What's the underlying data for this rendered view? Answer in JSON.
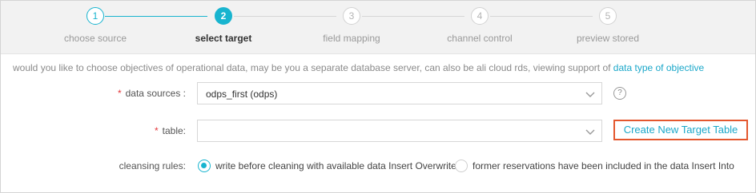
{
  "steps": [
    {
      "number": "1",
      "label": "choose source",
      "state": "done"
    },
    {
      "number": "2",
      "label": "select target",
      "state": "active"
    },
    {
      "number": "3",
      "label": "field mapping",
      "state": "todo"
    },
    {
      "number": "4",
      "label": "channel control",
      "state": "todo"
    },
    {
      "number": "5",
      "label": "preview stored",
      "state": "todo"
    }
  ],
  "info": {
    "text": "would you like to choose objectives of operational data, may be you a separate database server, can also be ali cloud rds, viewing support of ",
    "link": "data type of objective"
  },
  "form": {
    "data_sources": {
      "required_mark": "*",
      "label": "data sources :",
      "value": "odps_first (odps)",
      "help": "?"
    },
    "table": {
      "required_mark": "*",
      "label": "table:",
      "value": "",
      "button": "Create New Target Table"
    },
    "cleansing": {
      "label": "cleansing rules:",
      "options": [
        {
          "label": "write before cleaning with available data Insert Overwrite",
          "checked": true
        },
        {
          "label": "former reservations have been included in the data Insert Into",
          "checked": false
        }
      ]
    }
  },
  "colors": {
    "accent": "#18b4cf",
    "highlight": "#e4572e",
    "required": "#e4393c"
  }
}
